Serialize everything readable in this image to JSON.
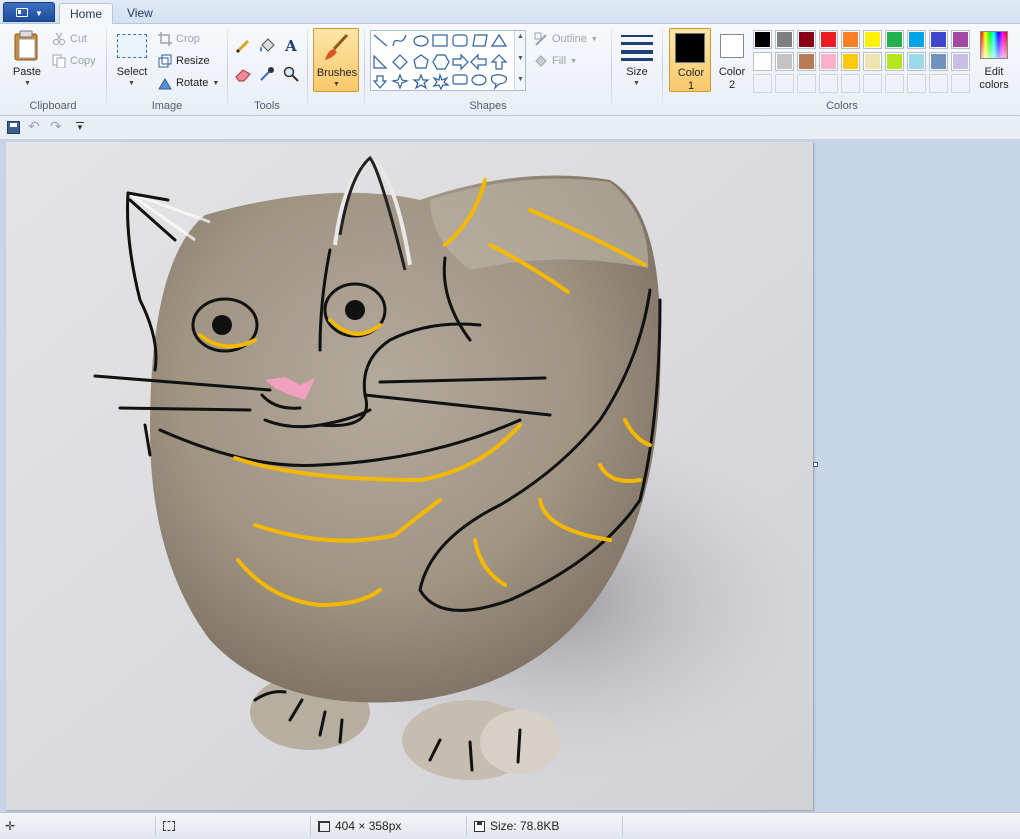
{
  "tabs": [
    {
      "label": "Home",
      "active": true
    },
    {
      "label": "View",
      "active": false
    }
  ],
  "clipboard": {
    "paste_label": "Paste",
    "cut_label": "Cut",
    "copy_label": "Copy",
    "group_label": "Clipboard"
  },
  "image": {
    "select_label": "Select",
    "crop_label": "Crop",
    "resize_label": "Resize",
    "rotate_label": "Rotate",
    "group_label": "Image"
  },
  "tools": {
    "group_label": "Tools",
    "items": [
      "pencil-icon",
      "fill-icon",
      "text-icon",
      "eraser-icon",
      "color-picker-icon",
      "magnifier-icon"
    ]
  },
  "brushes": {
    "label": "Brushes"
  },
  "shapes": {
    "group_label": "Shapes",
    "outline_label": "Outline",
    "fill_label": "Fill"
  },
  "size": {
    "label": "Size"
  },
  "colors": {
    "color1_label": "Color",
    "color1_num": "1",
    "color2_label": "Color",
    "color2_num": "2",
    "edit_label_1": "Edit",
    "edit_label_2": "colors",
    "group_label": "Colors",
    "color1_value": "#000000",
    "color2_value": "#ffffff",
    "palette_row1": [
      "#000000",
      "#7f7f7f",
      "#880015",
      "#ed1c24",
      "#ff7f27",
      "#fff200",
      "#22b14c",
      "#00a2e8",
      "#3f48cc",
      "#a349a4"
    ],
    "palette_row2": [
      "#ffffff",
      "#c3c3c3",
      "#b97a57",
      "#ffaec9",
      "#ffc90e",
      "#efe4b0",
      "#b5e61d",
      "#99d9ea",
      "#7092be",
      "#c8bfe7"
    ]
  },
  "statusbar": {
    "dimensions": "404 × 358px",
    "size": "Size: 78.8KB"
  }
}
